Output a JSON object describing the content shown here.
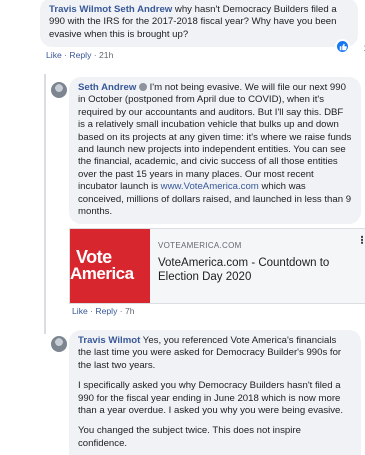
{
  "comment1": {
    "author": "Travis Wilmot",
    "mention": "Seth Andrew",
    "text": "why hasn't Democracy Builders filed a 990 with the IRS for the 2017-2018 fiscal year? Why have you been evasive when this is brought up?",
    "reactions": "1",
    "actions": {
      "like": "Like",
      "reply": "Reply",
      "time": "21h"
    }
  },
  "reply1": {
    "author": "Seth Andrew",
    "text_before_link": "I'm not being evasive. We will file our next 990 in October (postponed from April due to COVID), when it's required by our accountants and auditors. But I'll say this. DBF is a relatively small incubation vehicle that bulks up and down based on its projects at any given time: it's where we raise funds and launch new projects into independent entities. You can see the financial, academic, and civic success of all those entities over the past 15 years in many places. Our most recent incubator launch is",
    "link": "www.VoteAmerica.com",
    "text_after_link": "which was conceived, millions of dollars raised, and launched in less than 9 months.",
    "actions": {
      "like": "Like",
      "reply": "Reply",
      "time": "7h"
    }
  },
  "link_preview": {
    "image_text_line1": "Vote",
    "image_text_line2": "America",
    "domain": "VOTEAMERICA.COM",
    "title": "VoteAmerica.com - Countdown to Election Day 2020",
    "brand_color": "#d8262e"
  },
  "reply2": {
    "author": "Travis Wilmot",
    "paragraphs": [
      "Yes, you referenced Vote America's financials the last time you were asked for Democracy Builder's 990s for the last two years.",
      "I specifically asked you why Democracy Builders hasn't filed a 990 for the fiscal year ending in June 2018 which is now more than a year overdue. I asked you why you were being evasive.",
      "You changed the subject twice. This does not inspire confidence."
    ]
  },
  "colors": {
    "name_blue": "#385898",
    "bubble_bg": "#f0f2f5",
    "reaction_blue": "#1877f2"
  }
}
